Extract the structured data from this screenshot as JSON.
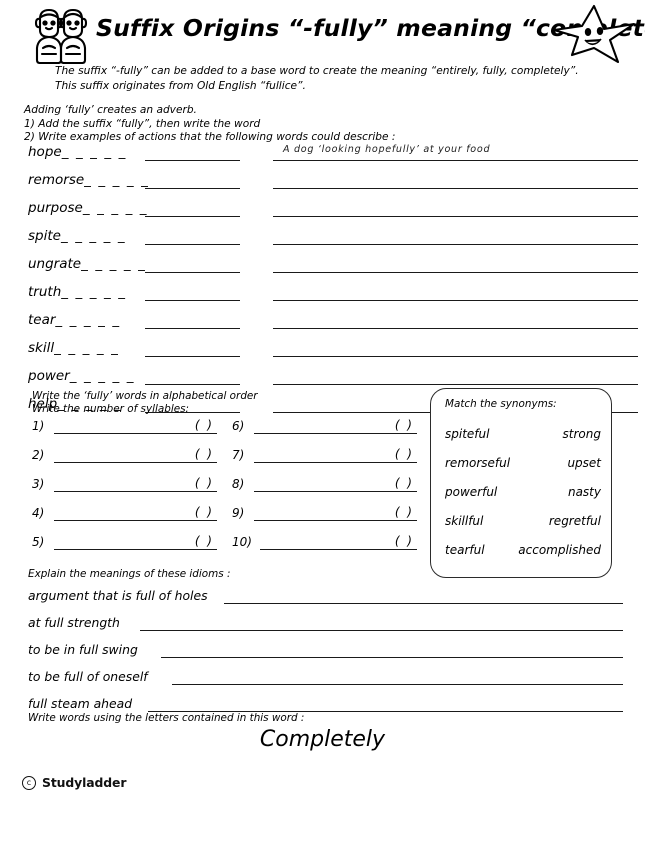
{
  "header": {
    "title": "Suffix Origins “-fully” meaning “completely”",
    "kids_icon": "two-children-icon",
    "star_icon": "smiling-star-icon"
  },
  "intro": {
    "line1": "The suffix “-fully” can be added to a base word to create the meaning “entirely, fully, completely”.",
    "line2": "This suffix originates from Old English “fullice”."
  },
  "instructions": {
    "line1": "Adding ‘fully’ creates an adverb.",
    "line2": "1) Add the suffix “fully”, then write the word",
    "line3": "2) Write examples of actions that the following words could describe :"
  },
  "word_rows": [
    {
      "stem": "hope",
      "dashes": "_ _ _ _ _",
      "example": "A dog ‘looking hopefully’ at your food"
    },
    {
      "stem": "remorse",
      "dashes": "_ _ _ _ _",
      "example": ""
    },
    {
      "stem": "purpose",
      "dashes": "_ _ _ _ _",
      "example": ""
    },
    {
      "stem": "spite",
      "dashes": "_ _ _ _ _",
      "example": ""
    },
    {
      "stem": "ungrate",
      "dashes": "_ _ _ _ _",
      "example": ""
    },
    {
      "stem": "truth",
      "dashes": "_ _ _ _ _",
      "example": ""
    },
    {
      "stem": "tear",
      "dashes": "_ _ _ _ _",
      "example": ""
    },
    {
      "stem": "skill",
      "dashes": "_ _ _ _ _",
      "example": ""
    },
    {
      "stem": "power",
      "dashes": "_ _ _ _ _",
      "example": ""
    },
    {
      "stem": "help",
      "dashes": "_ _ _ _ _",
      "example": ""
    }
  ],
  "alphabetical": {
    "heading_line1": "Write the ‘fully’ words in alphabetical order",
    "heading_line2": "Write the number of syllables:",
    "paren": "(  )",
    "left_items": [
      {
        "num": "1)"
      },
      {
        "num": "2)"
      },
      {
        "num": "3)"
      },
      {
        "num": "4)"
      },
      {
        "num": "5)"
      }
    ],
    "right_items": [
      {
        "num": "6)"
      },
      {
        "num": "7)"
      },
      {
        "num": "8)"
      },
      {
        "num": "9)"
      },
      {
        "num": "10)"
      }
    ]
  },
  "synonyms": {
    "title": "Match the synonyms:",
    "pairs": [
      {
        "left": "spiteful",
        "right": "strong"
      },
      {
        "left": "remorseful",
        "right": "upset"
      },
      {
        "left": "powerful",
        "right": "nasty"
      },
      {
        "left": "skillful",
        "right": "regretful"
      },
      {
        "left": "tearful",
        "right": "accomplished"
      }
    ]
  },
  "idioms": {
    "heading": "Explain the meanings of these idioms :",
    "items": [
      {
        "text": "argument that is full of holes"
      },
      {
        "text": "at full strength"
      },
      {
        "text": "to be in full swing"
      },
      {
        "text": "to be full of oneself"
      },
      {
        "text": "full steam ahead"
      }
    ]
  },
  "letters_task": {
    "heading": "Write words using the letters contained in this word :",
    "word": "Completely"
  },
  "footer": {
    "copyright": "c",
    "brand": "Studyladder"
  },
  "colors": {
    "ink": "#000000",
    "rule": "#1a1a1a",
    "box_border": "#2b2b2b"
  }
}
